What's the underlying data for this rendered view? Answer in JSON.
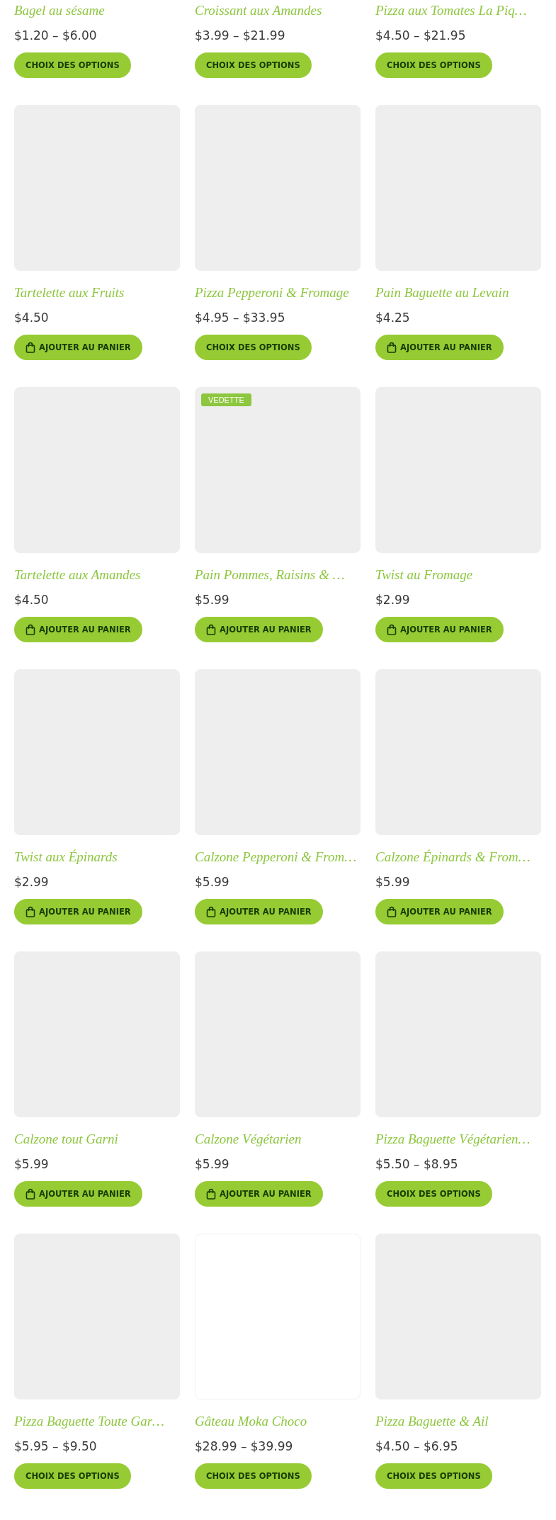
{
  "rows": [
    [
      {
        "title": "Bagel au sésame",
        "price": "$1.20 – $6.00",
        "button": {
          "kind": "options",
          "label": "CHOIX DES OPTIONS"
        }
      },
      {
        "title": "Croissant aux Amandes",
        "price": "$3.99 – $21.99",
        "button": {
          "kind": "options",
          "label": "CHOIX DES OPTIONS"
        }
      },
      {
        "title": "Pizza aux Tomates La Piq…",
        "price": "$4.50 – $21.95",
        "button": {
          "kind": "options",
          "label": "CHOIX DES OPTIONS"
        }
      }
    ],
    [
      {
        "image": {
          "kind": "gray"
        },
        "title": "Tartelette aux Fruits",
        "price": "$4.50",
        "button": {
          "kind": "cart",
          "label": "AJOUTER AU PANIER"
        }
      },
      {
        "image": {
          "kind": "gray"
        },
        "title": "Pizza Pepperoni & Fromage",
        "price": "$4.95 – $33.95",
        "button": {
          "kind": "options",
          "label": "CHOIX DES OPTIONS"
        }
      },
      {
        "image": {
          "kind": "gray"
        },
        "title": "Pain Baguette au Levain",
        "price": "$4.25",
        "button": {
          "kind": "cart",
          "label": "AJOUTER AU PANIER"
        }
      }
    ],
    [
      {
        "image": {
          "kind": "gray"
        },
        "title": "Tartelette aux Amandes",
        "price": "$4.50",
        "button": {
          "kind": "cart",
          "label": "AJOUTER AU PANIER"
        }
      },
      {
        "image": {
          "kind": "gray"
        },
        "badge": "VEDETTE",
        "title": "Pain Pommes, Raisins & …",
        "price": "$5.99",
        "button": {
          "kind": "cart",
          "label": "AJOUTER AU PANIER"
        }
      },
      {
        "image": {
          "kind": "gray"
        },
        "title": "Twist au Fromage",
        "price": "$2.99",
        "button": {
          "kind": "cart",
          "label": "AJOUTER AU PANIER"
        }
      }
    ],
    [
      {
        "image": {
          "kind": "gray"
        },
        "title": "Twist aux Épinards",
        "price": "$2.99",
        "button": {
          "kind": "cart",
          "label": "AJOUTER AU PANIER"
        }
      },
      {
        "image": {
          "kind": "gray"
        },
        "title": "Calzone Pepperoni & From…",
        "price": "$5.99",
        "button": {
          "kind": "cart",
          "label": "AJOUTER AU PANIER"
        }
      },
      {
        "image": {
          "kind": "gray"
        },
        "title": "Calzone Épinards & From…",
        "price": "$5.99",
        "button": {
          "kind": "cart",
          "label": "AJOUTER AU PANIER"
        }
      }
    ],
    [
      {
        "image": {
          "kind": "gray"
        },
        "title": "Calzone tout Garni",
        "price": "$5.99",
        "button": {
          "kind": "cart",
          "label": "AJOUTER AU PANIER"
        }
      },
      {
        "image": {
          "kind": "gray"
        },
        "title": "Calzone Végétarien",
        "price": "$5.99",
        "button": {
          "kind": "cart",
          "label": "AJOUTER AU PANIER"
        }
      },
      {
        "image": {
          "kind": "gray"
        },
        "title": "Pizza Baguette Végétarien…",
        "price": "$5.50 – $8.95",
        "button": {
          "kind": "options",
          "label": "CHOIX DES OPTIONS"
        }
      }
    ],
    [
      {
        "image": {
          "kind": "gray"
        },
        "title": "Pizza Baguette Toute Gar…",
        "price": "$5.95 – $9.50",
        "button": {
          "kind": "options",
          "label": "CHOIX DES OPTIONS"
        }
      },
      {
        "image": {
          "kind": "white"
        },
        "title": "Gâteau Moka Choco",
        "price": "$28.99 – $39.99",
        "button": {
          "kind": "options",
          "label": "CHOIX DES OPTIONS"
        }
      },
      {
        "image": {
          "kind": "gray"
        },
        "title": "Pizza Baguette & Ail",
        "price": "$4.50 – $6.95",
        "button": {
          "kind": "options",
          "label": "CHOIX DES OPTIONS"
        }
      }
    ]
  ]
}
